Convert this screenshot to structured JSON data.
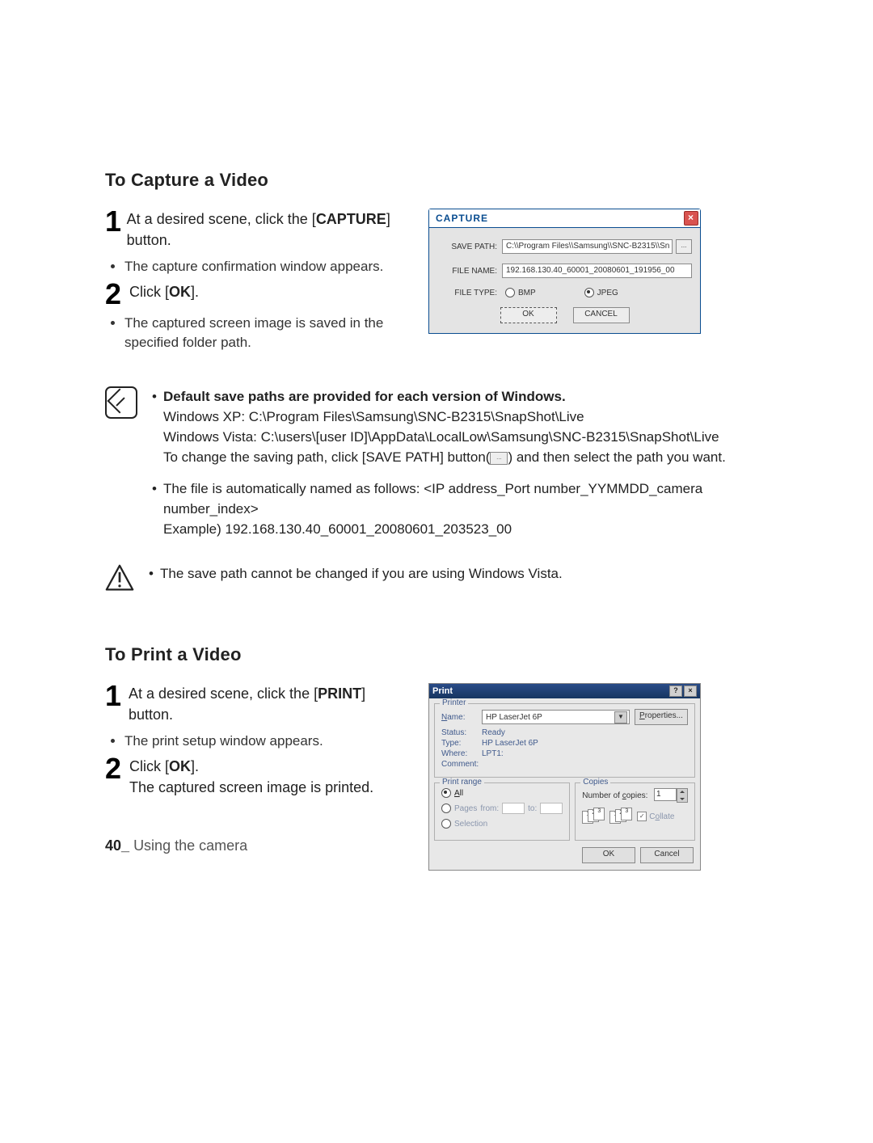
{
  "section1": {
    "title": "To Capture a Video",
    "step1_a": "At a desired scene, click the ",
    "step1_b": "[",
    "step1_bold": "CAPTURE",
    "step1_c": "] button.",
    "bullet1": "The capture confirmation window appears.",
    "step2_a": "Click [",
    "step2_bold": "OK",
    "step2_b": "].",
    "bullet2": "The captured screen image is saved in the specified folder path."
  },
  "capture_dialog": {
    "title": "CAPTURE",
    "save_path_label": "SAVE PATH:",
    "save_path_value": "C:\\\\Program Files\\\\Samsung\\\\SNC-B2315\\\\Sn",
    "browse": "...",
    "file_name_label": "FILE NAME:",
    "file_name_value": "192.168.130.40_60001_20080601_191956_00",
    "file_type_label": "FILE TYPE:",
    "radio_bmp": "BMP",
    "radio_jpeg": "JPEG",
    "ok": "OK",
    "cancel": "CANCEL"
  },
  "note": {
    "li1_bold": "Default save paths are provided for each version of Windows.",
    "li1_l1": "Windows XP: C:\\Program Files\\Samsung\\SNC-B2315\\SnapShot\\Live",
    "li1_l2": "Windows Vista: C:\\users\\[user ID]\\AppData\\LocalLow\\Samsung\\SNC-B2315\\SnapShot\\Live",
    "li1_l3a": "To change the saving path, click [",
    "li1_l3bold": "SAVE PATH",
    "li1_l3b": "] button(",
    "li1_l3c": ") and then select the path you want.",
    "li2_l1": "The file is automatically named as follows: <IP address_Port number_YYMMDD_camera number_index>",
    "li2_l2": "Example) 192.168.130.40_60001_20080601_203523_00"
  },
  "warn": {
    "text": "The save path cannot be changed if you are using Windows Vista."
  },
  "section2": {
    "title": "To Print a Video",
    "step1_a": "At a desired scene, click the [",
    "step1_bold": "PRINT",
    "step1_b": "] button.",
    "bullet1": "The print setup window appears.",
    "step2_a": "Click [",
    "step2_bold": "OK",
    "step2_b": "].",
    "step2_line2": "The captured screen image is printed."
  },
  "print_dialog": {
    "title": "Print",
    "printer_legend": "Printer",
    "name_label": "Name:",
    "name_value": "HP LaserJet 6P",
    "properties": "Properties...",
    "status_label": "Status:",
    "status_value": "Ready",
    "type_label": "Type:",
    "type_value": "HP LaserJet 6P",
    "where_label": "Where:",
    "where_value": "LPT1:",
    "comment_label": "Comment:",
    "range_legend": "Print range",
    "all": "All",
    "pages": "Pages",
    "from": "from:",
    "to": "to:",
    "selection": "Selection",
    "copies_legend": "Copies",
    "copies_label": "Number of copies:",
    "copies_value": "1",
    "collate": "Collate",
    "ok": "OK",
    "cancel": "Cancel"
  },
  "footer": {
    "page": "40_",
    "label": "Using the camera"
  },
  "ellipsis": "..."
}
